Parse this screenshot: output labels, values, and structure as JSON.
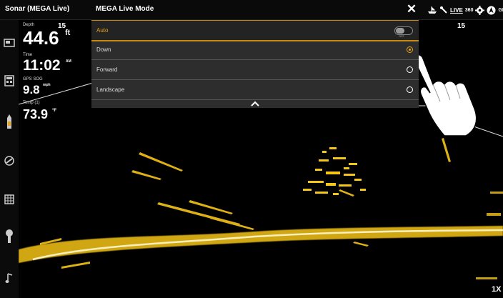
{
  "header": {
    "app_title": "Sonar (MEGA Live)",
    "menu_title": "MEGA Live Mode",
    "close_label": "✕",
    "status": {
      "live_label": "LIVE",
      "s360_label": "360",
      "gps_label": "GP"
    }
  },
  "menu": {
    "auto": {
      "label": "Auto",
      "toggle_state": "OFF",
      "enabled": false
    },
    "options": [
      {
        "label": "Down",
        "selected": true
      },
      {
        "label": "Forward",
        "selected": false
      },
      {
        "label": "Landscape",
        "selected": false
      }
    ]
  },
  "data_overlay": {
    "depth": {
      "label": "Depth",
      "value": "44.6",
      "unit": "ft"
    },
    "time": {
      "label": "Time",
      "value": "11:02",
      "suffix": "AM"
    },
    "gps_sog": {
      "label": "GPS SOG",
      "value": "9.8",
      "unit": "mph"
    },
    "temp": {
      "label": "Temp (1)",
      "value": "73.9",
      "unit": "°F"
    }
  },
  "sonar": {
    "scale_left_top": "15",
    "scale_right_top": "15",
    "zoom_label": "1X"
  },
  "colors": {
    "accent": "#e8a317",
    "menu_bg": "#2d2d2d",
    "sonar_return": "#f5c518"
  },
  "icons": {
    "sidebar": [
      "chart-icon",
      "calculator-icon",
      "boat-view-icon",
      "satellite-icon",
      "grid-icon",
      "transducer-icon",
      "music-icon"
    ],
    "status": [
      "boat-icon",
      "tool-icon",
      "live-icon",
      "360-icon",
      "settings-icon",
      "navigation-icon",
      "gps-icon"
    ]
  }
}
